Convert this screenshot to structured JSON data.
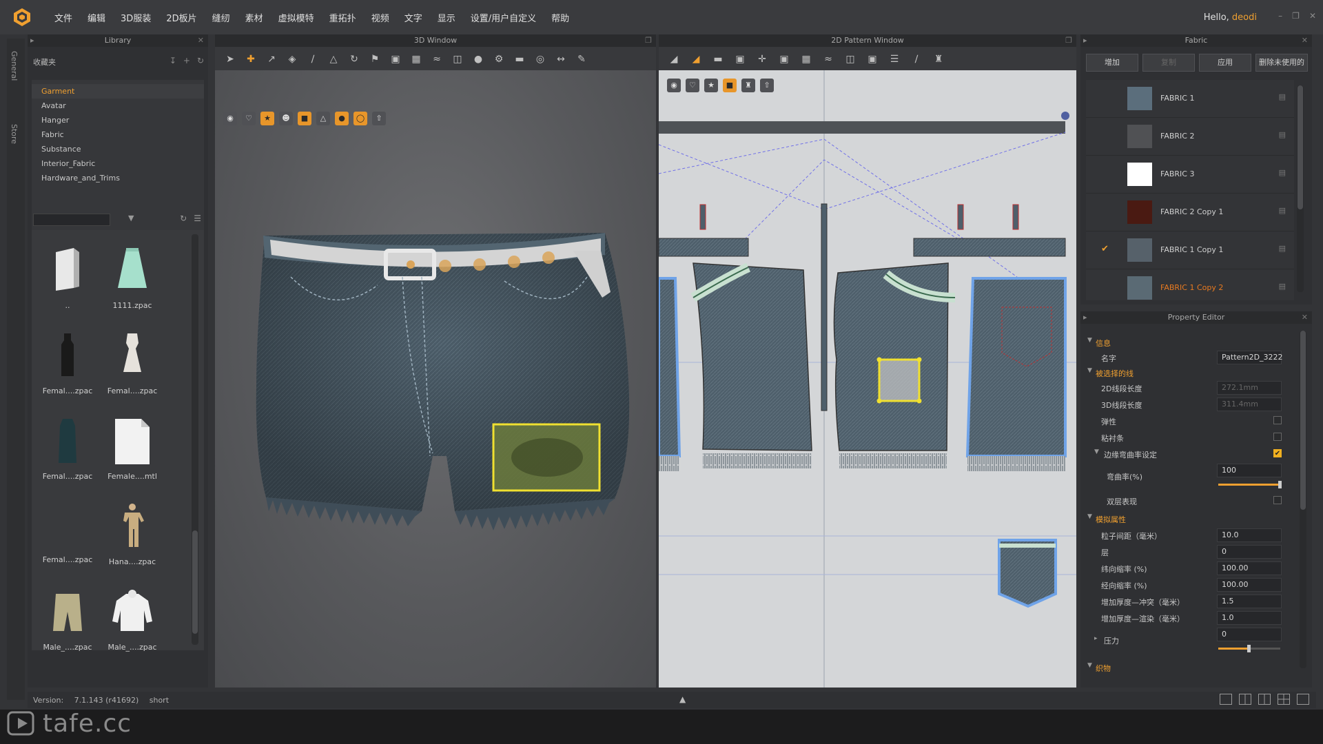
{
  "menu": {
    "items": [
      "文件",
      "编辑",
      "3D服装",
      "2D板片",
      "缝纫",
      "素材",
      "虚拟模特",
      "重拓扑",
      "视频",
      "文字",
      "显示",
      "设置/用户自定义",
      "帮助"
    ],
    "greeting_prefix": "Hello, ",
    "username": "deodi"
  },
  "side_tabs": [
    "General",
    "Store"
  ],
  "library": {
    "title": "Library",
    "folder_label": "收藏夹",
    "tree": [
      "Garment",
      "Avatar",
      "Hanger",
      "Fabric",
      "Substance",
      "Interior_Fabric",
      "Hardware_and_Trims"
    ],
    "active_tree_item": "Garment",
    "search_value": "",
    "items": [
      "..",
      "1111.zpac",
      "Femal....zpac",
      "Femal....zpac",
      "Femal....zpac",
      "Female....mtl",
      "Femal....zpac",
      "Hana....zpac",
      "Male_....zpac",
      "Male_....zpac"
    ]
  },
  "window_3d": {
    "title": "3D Window"
  },
  "window_2d": {
    "title": "2D Pattern Window"
  },
  "fabric_panel": {
    "title": "Fabric",
    "buttons": [
      "增加",
      "复制",
      "应用",
      "删除未使用的"
    ],
    "fabrics": [
      {
        "name": "FABRIC 1",
        "color": "#5b6e7c",
        "checked": false
      },
      {
        "name": "FABRIC 2",
        "color": "#505154",
        "checked": false
      },
      {
        "name": "FABRIC 3",
        "color": "#ffffff",
        "checked": false
      },
      {
        "name": "FABRIC 2 Copy 1",
        "color": "#4a1a12",
        "checked": false
      },
      {
        "name": "FABRIC 1 Copy 1",
        "color": "#56616a",
        "checked": true
      },
      {
        "name": "FABRIC 1 Copy 2",
        "color": "#5a6a74",
        "checked": false
      }
    ]
  },
  "property_editor": {
    "title": "Property Editor",
    "sections": {
      "info": "信息",
      "selected_line": "被选择的线",
      "simulation": "模拟属性",
      "fabric": "织物"
    },
    "name_label": "名字",
    "name_value": "Pattern2D_3222",
    "line_2d_label": "2D线段长度",
    "line_2d_value": "272.1mm",
    "line_3d_label": "3D线段长度",
    "line_3d_value": "311.4mm",
    "elastic_label": "弹性",
    "fusible_label": "粘衬条",
    "curvature_setting_label": "边缘弯曲率设定",
    "curvature_label": "弯曲率(%)",
    "curvature_value": "100",
    "curvature_fraction": 1.0,
    "double_side_label": "双层表现",
    "particle_label": "粒子间距（毫米）",
    "particle_value": "10.0",
    "layer_label": "层",
    "layer_value": "0",
    "weft_label": "纬向缩率 (%)",
    "weft_value": "100.00",
    "warp_label": "经向缩率 (%)",
    "warp_value": "100.00",
    "thickness_col_label": "增加厚度—冲突（毫米）",
    "thickness_col_value": "1.5",
    "thickness_render_label": "增加厚度—渲染（毫米）",
    "thickness_render_value": "1.0",
    "pressure_label": "压力",
    "pressure_value": "0",
    "pressure_fraction": 0.5,
    "fabric_row_label": "织物"
  },
  "status": {
    "version_label": "Version:",
    "version_value": "7.1.143 (r41692)",
    "garment_name": "short"
  },
  "watermark": "tafe.cc",
  "accent_color": "#f0a030"
}
